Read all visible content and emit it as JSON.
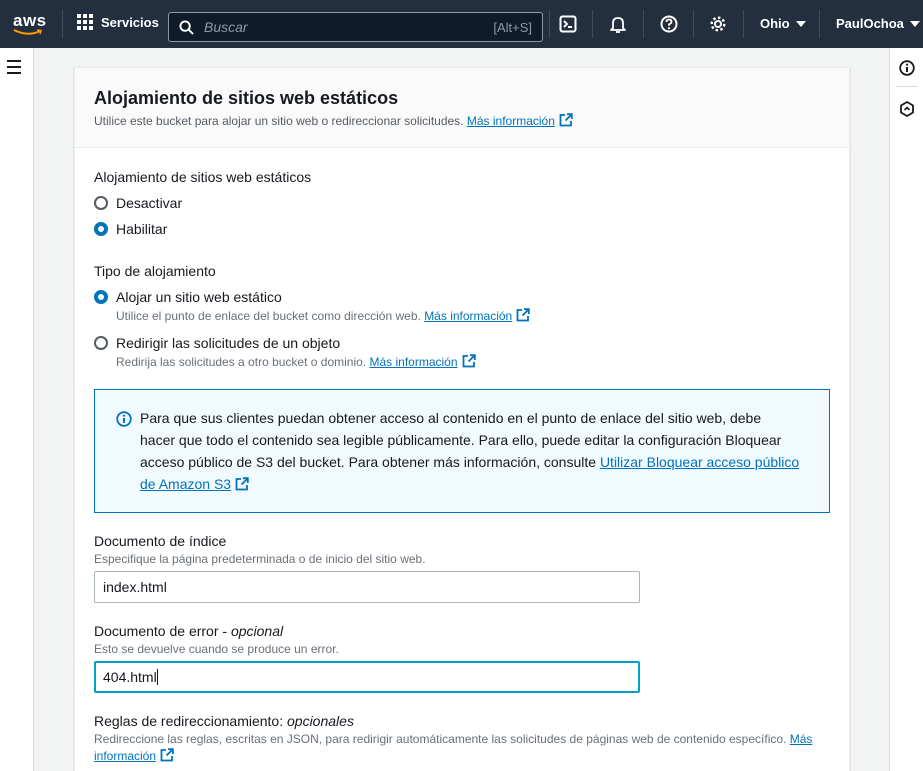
{
  "topnav": {
    "logo": "aws",
    "services_label": "Servicios",
    "search_placeholder": "Buscar",
    "search_shortcut": "[Alt+S]",
    "icons": [
      "cloudshell-icon",
      "bell-icon",
      "help-icon",
      "gear-icon"
    ],
    "region": "Ohio",
    "user": "PaulOchoa"
  },
  "panel": {
    "title": "Alojamiento de sitios web estáticos",
    "description": "Utilice este bucket para alojar un sitio web o redireccionar solicitudes.",
    "more_info": "Más información",
    "hosting": {
      "label": "Alojamiento de sitios web estáticos",
      "options": [
        "Desactivar",
        "Habilitar"
      ],
      "selected": "Habilitar"
    },
    "hosting_type": {
      "label": "Tipo de alojamiento",
      "option1": "Alojar un sitio web estático",
      "option1_desc": "Utilice el punto de enlace del bucket como dirección web.",
      "option2": "Redirigir las solicitudes de un objeto",
      "option2_desc": "Redirija las solicitudes a otro bucket o dominio.",
      "more_info": "Más información",
      "selected": "Alojar un sitio web estático"
    },
    "alert": {
      "text": "Para que sus clientes puedan obtener acceso al contenido en el punto de enlace del sitio web, debe hacer que todo el contenido sea legible públicamente. Para ello, puede editar la configuración Bloquear acceso público de S3 del bucket. Para obtener más información, consulte",
      "link": "Utilizar Bloquear acceso público de Amazon S3"
    },
    "index_doc": {
      "label": "Documento de índice",
      "desc": "Especifique la página predeterminada o de inicio del sitio web.",
      "value": "index.html"
    },
    "error_doc": {
      "label": "Documento de error - ",
      "optional": "opcional",
      "desc": "Esto se devuelve cuando se produce un error.",
      "value": "404.html"
    },
    "redirect_rules": {
      "label": "Reglas de redireccionamiento: ",
      "optional": "opcionales",
      "desc": "Redireccione las reglas, escritas en JSON, para redirigir automáticamente las solicitudes de páginas web de contenido específico.",
      "more_info_1": "Más",
      "more_info_2": "información"
    }
  },
  "colors": {
    "nav_bg": "#232f3e",
    "link": "#0073bb",
    "alert_bg": "#f1faff",
    "focus": "#00a1c9"
  }
}
